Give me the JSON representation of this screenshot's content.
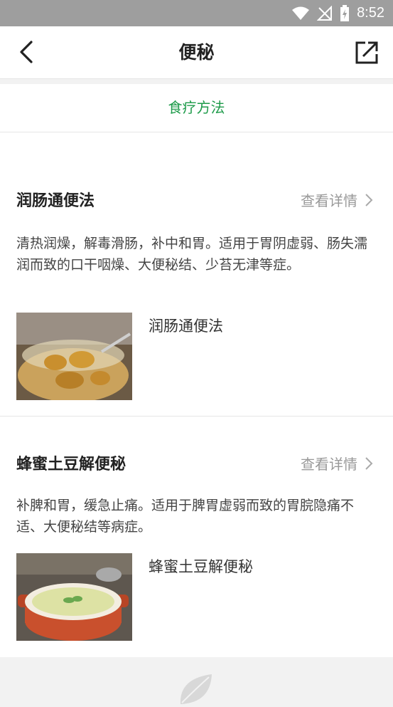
{
  "status_bar": {
    "time": "8:52"
  },
  "header": {
    "title": "便秘"
  },
  "tabs": [
    {
      "label": "食疗方法",
      "color": "#1e9b4a"
    }
  ],
  "items": [
    {
      "title": "润肠通便法",
      "link_label": "查看详情",
      "description": "清热润燥，解毒滑肠，补中和胃。适用于胃阴虚弱、肠失濡润而致的口干咽燥、大便秘结、少苔无津等症。",
      "thumb_label": "润肠通便法"
    },
    {
      "title": "蜂蜜土豆解便秘",
      "link_label": "查看详情",
      "description": "补脾和胃，缓急止痛。适用于脾胃虚弱而致的胃脘隐痛不适、大便秘结等病症。",
      "thumb_label": "蜂蜜土豆解便秘"
    }
  ]
}
